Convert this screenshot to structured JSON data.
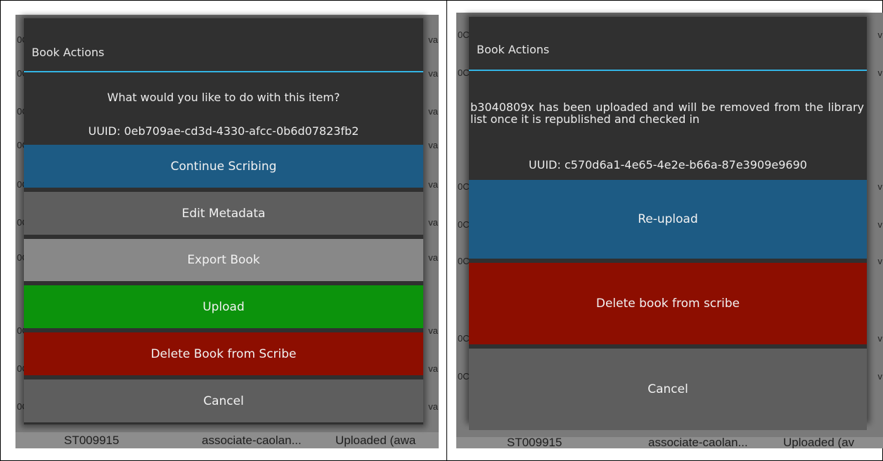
{
  "left": {
    "dialog_title": "Book Actions",
    "question": "What would you like to do with this item?",
    "uuid": "UUID: 0eb709ae-cd3d-4330-afcc-0b6d07823fb2",
    "buttons": {
      "continue": "Continue Scribing",
      "edit": "Edit Metadata",
      "export": "Export Book",
      "upload": "Upload",
      "delete": "Delete Book from Scribe",
      "cancel": "Cancel"
    },
    "background": {
      "row_left": "0C",
      "row_right": "va",
      "footer": {
        "id": "ST009915",
        "name": "associate-caolan...",
        "status": "Uploaded (awa"
      }
    }
  },
  "right": {
    "dialog_title": "Book Actions",
    "message": "b3040809x has been uploaded and will be removed from the library list once it is republished and checked in",
    "uuid": "UUID: c570d6a1-4e65-4e2e-b66a-87e3909e9690",
    "buttons": {
      "reupload": "Re-upload",
      "delete": "Delete book from scribe",
      "cancel": "Cancel"
    },
    "background": {
      "row_left": "0C",
      "row_right": "v",
      "footer": {
        "id": "ST009915",
        "name": "associate-caolan...",
        "status": "Uploaded (av"
      }
    }
  }
}
